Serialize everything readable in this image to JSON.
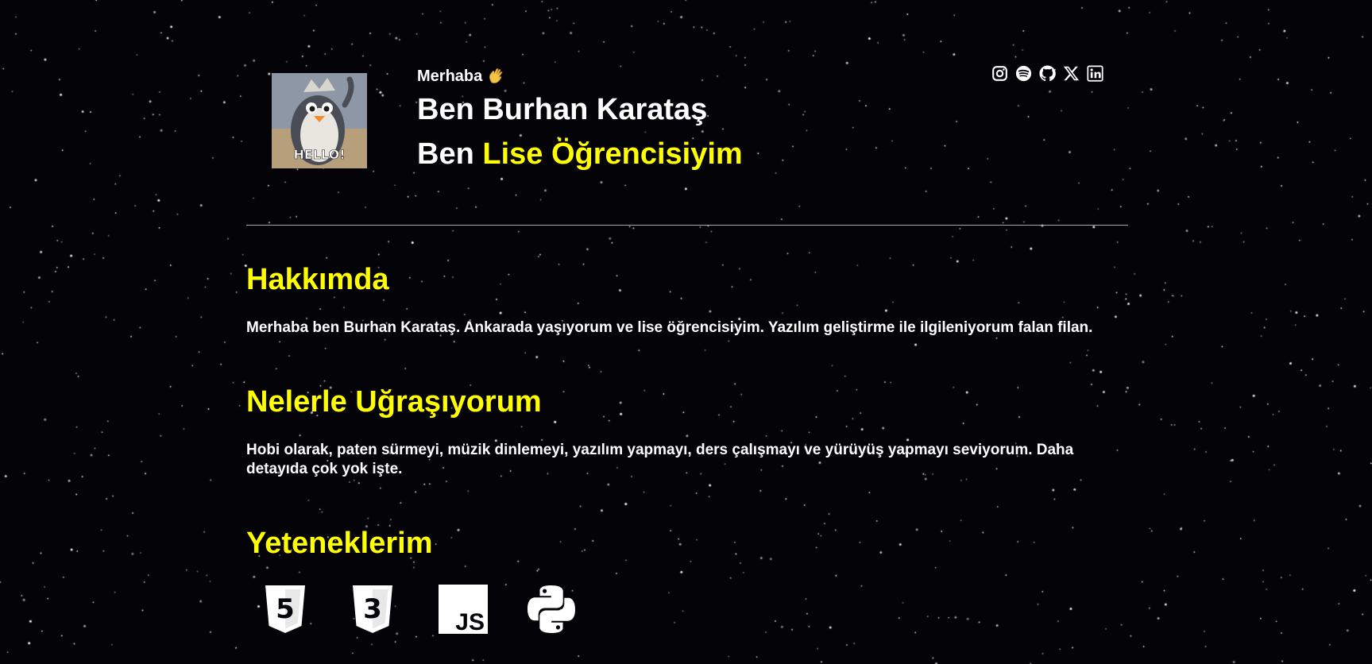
{
  "header": {
    "greeting": "Merhaba",
    "wave_emoji": "👋",
    "name_line": "Ben Burhan Karataş",
    "role_prefix": "Ben",
    "role_highlight": "Lise Öğrencisiyim",
    "avatar_caption": "HELLO!"
  },
  "socials": [
    {
      "icon": "instagram-icon"
    },
    {
      "icon": "spotify-icon"
    },
    {
      "icon": "github-icon"
    },
    {
      "icon": "x-icon"
    },
    {
      "icon": "linkedin-icon"
    }
  ],
  "sections": {
    "about": {
      "title": "Hakkımda",
      "text": "Merhaba ben Burhan Karataş. Ankarada yaşıyorum ve lise öğrencisiyim. Yazılım geliştirme ile ilgileniyorum falan filan."
    },
    "hobbies": {
      "title": "Nelerle Uğraşıyorum",
      "text": "Hobi olarak, paten sürmeyi, müzik dinlemeyi, yazılım yapmayı, ders çalışmayı ve yürüyüş yapmayı seviyorum. Daha detayıda çok yok işte."
    },
    "skills": {
      "title": "Yeteneklerim",
      "items": [
        {
          "icon": "html5-icon",
          "label": "5"
        },
        {
          "icon": "css3-icon",
          "label": "3"
        },
        {
          "icon": "javascript-icon",
          "label": "JS"
        },
        {
          "icon": "python-icon"
        }
      ]
    }
  },
  "colors": {
    "background": "#040308",
    "accent": "#ffff00",
    "text": "#ffffff"
  }
}
